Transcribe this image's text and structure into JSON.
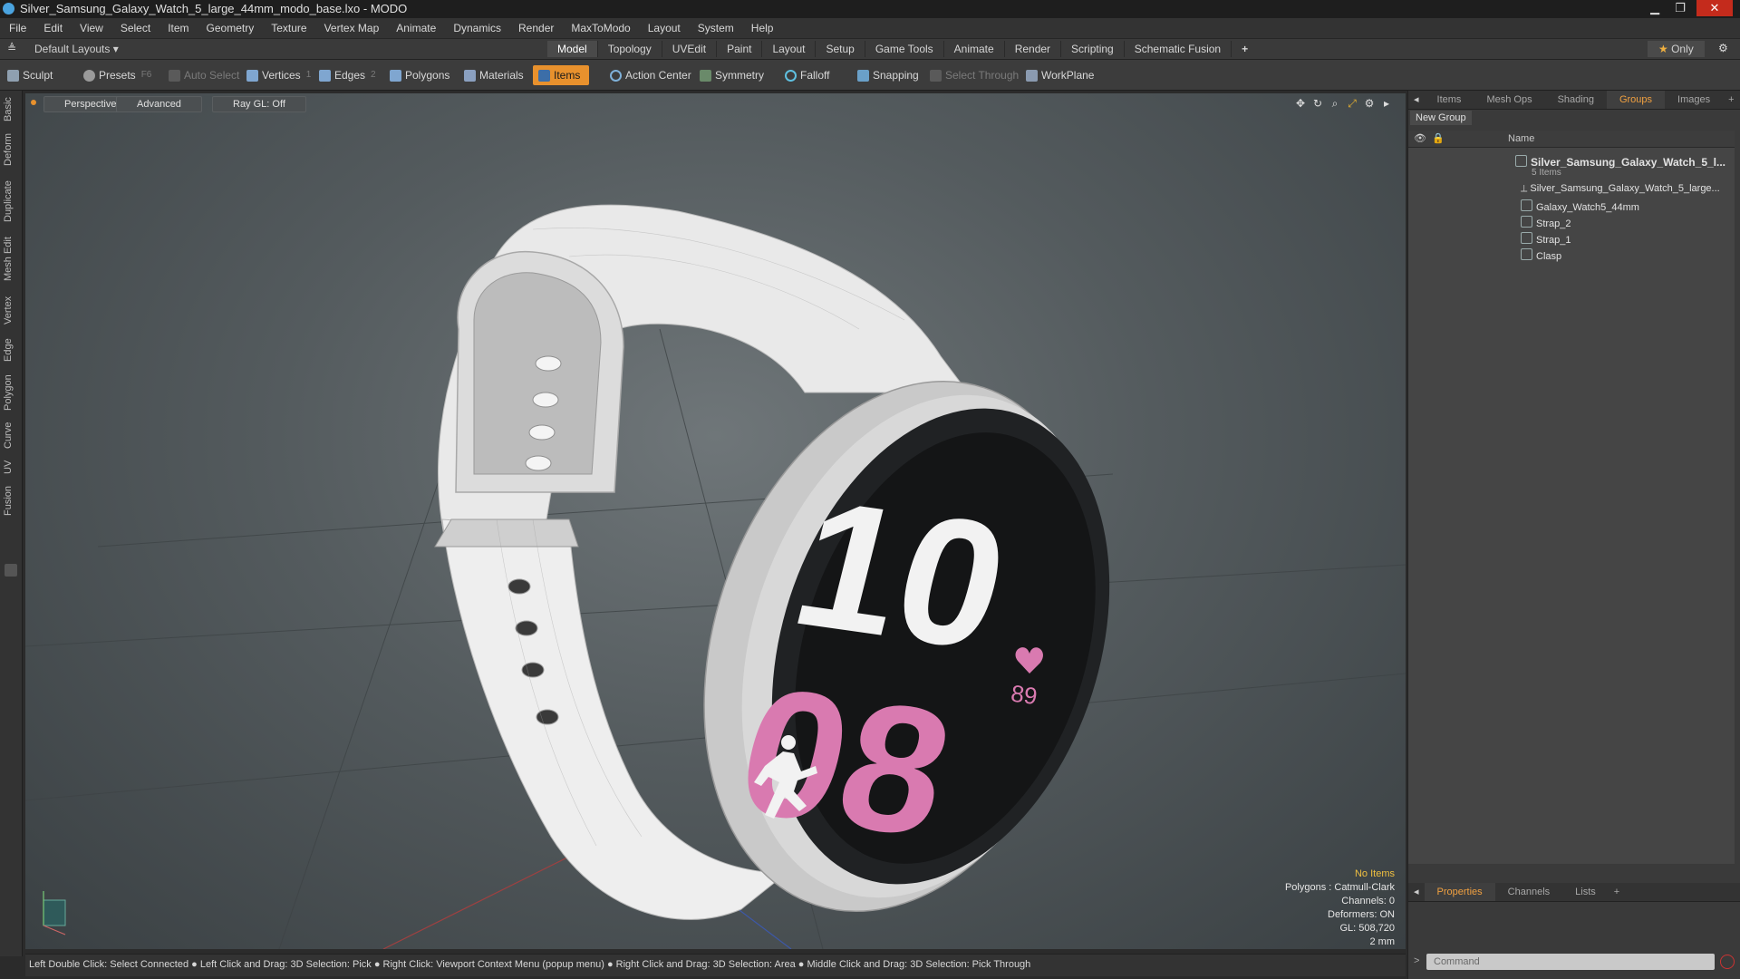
{
  "window": {
    "title": "Silver_Samsung_Galaxy_Watch_5_large_44mm_modo_base.lxo - MODO"
  },
  "menu": [
    "File",
    "Edit",
    "View",
    "Select",
    "Item",
    "Geometry",
    "Texture",
    "Vertex Map",
    "Animate",
    "Dynamics",
    "Render",
    "MaxToModo",
    "Layout",
    "System",
    "Help"
  ],
  "layout_bar": {
    "layouts_label": "Default Layouts",
    "tabs": [
      "Model",
      "Topology",
      "UVEdit",
      "Paint",
      "Layout",
      "Setup",
      "Game Tools",
      "Animate",
      "Render",
      "Scripting",
      "Schematic Fusion"
    ],
    "active_tab": "Model",
    "only_label": "Only"
  },
  "toolbar": {
    "sculpt": "Sculpt",
    "presets": "Presets",
    "presets_key": "F6",
    "auto_select": "Auto Select",
    "vertices": "Vertices",
    "vertices_count": "1",
    "edges": "Edges",
    "edges_count": "2",
    "polygons": "Polygons",
    "materials": "Materials",
    "items": "Items",
    "action_center": "Action Center",
    "symmetry": "Symmetry",
    "falloff": "Falloff",
    "snapping": "Snapping",
    "select_through": "Select Through",
    "workplane": "WorkPlane"
  },
  "left_tabs": [
    "Basic",
    "Deform",
    "Duplicate",
    "Mesh Edit",
    "Vertex",
    "Edge",
    "Polygon",
    "Curve",
    "UV",
    "Fusion"
  ],
  "viewport": {
    "view_mode": "Perspective",
    "shading": "Advanced",
    "raygl": "Ray GL: Off",
    "watch_hour": "10",
    "watch_minute": "08",
    "watch_hr": "89",
    "info": {
      "selection": "No Items",
      "polygons": "Polygons : Catmull-Clark",
      "channels": "Channels: 0",
      "deformers": "Deformers: ON",
      "gl": "GL: 508,720",
      "scale": "2 mm"
    }
  },
  "status_bar": "Left Double Click: Select Connected ● Left Click and Drag: 3D Selection: Pick ● Right Click: Viewport Context Menu (popup menu) ● Right Click and Drag: 3D Selection: Area ● Middle Click and Drag: 3D Selection: Pick Through",
  "right_panel": {
    "tabs": [
      "Items",
      "Mesh Ops",
      "Shading",
      "Groups",
      "Images"
    ],
    "active_tab": "Groups",
    "new_group": "New Group",
    "column_name": "Name",
    "group_name": "Silver_Samsung_Galaxy_Watch_5_l...",
    "group_count": "5 Items",
    "items": [
      "Silver_Samsung_Galaxy_Watch_5_large...",
      "Galaxy_Watch5_44mm",
      "Strap_2",
      "Strap_1",
      "Clasp"
    ],
    "bottom_tabs": [
      "Properties",
      "Channels",
      "Lists"
    ],
    "bottom_active": "Properties",
    "command_placeholder": "Command"
  },
  "colors": {
    "accent": "#e8912d",
    "watch_pink": "#d97ab0",
    "bezel": "#202224",
    "strap": "#ececec"
  }
}
